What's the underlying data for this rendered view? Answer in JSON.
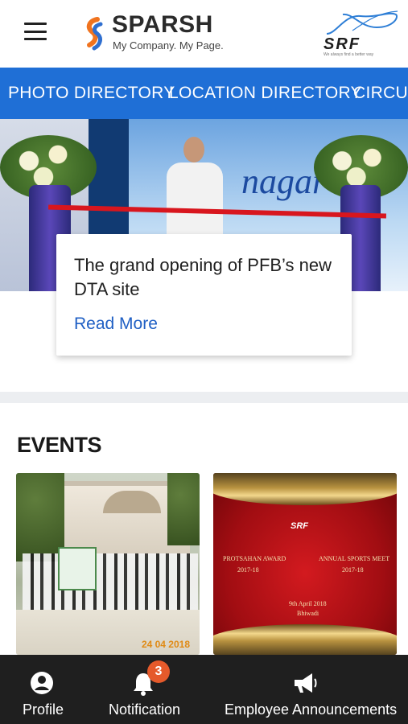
{
  "header": {
    "logo_title": "SPARSH",
    "logo_tagline": "My Company. My Page.",
    "brand": "SRF",
    "brand_tagline": "We always find a better way"
  },
  "nav": {
    "items": [
      "PHOTO DIRECTORY",
      "LOCATION DIRECTORY",
      "CIRCUL"
    ]
  },
  "featured": {
    "banner_sign_text": "nagar",
    "title": "The grand opening of PFB’s new DTA site",
    "link": "Read More"
  },
  "events": {
    "heading": "EVENTS",
    "cards": [
      {
        "date": "24 04 2018"
      },
      {
        "logo": "SRF",
        "left_line1": "PROTSAHAN AWARD",
        "left_line2": "2017-18",
        "right_line1": "ANNUAL SPORTS MEET",
        "right_line2": "2017-18",
        "bottom_line1": "9th April 2018",
        "bottom_line2": "Bhiwadi"
      }
    ]
  },
  "bottom_nav": {
    "items": [
      {
        "label": "Profile",
        "icon": "profile-icon"
      },
      {
        "label": "Notification",
        "icon": "bell-icon",
        "badge": "3"
      },
      {
        "label": "Employee Announcements",
        "icon": "megaphone-icon"
      }
    ]
  },
  "colors": {
    "nav_blue": "#1f6fd6",
    "link_blue": "#1f5fc4",
    "badge_orange": "#e55a2b",
    "bottom_bar": "#1f1f1f"
  }
}
